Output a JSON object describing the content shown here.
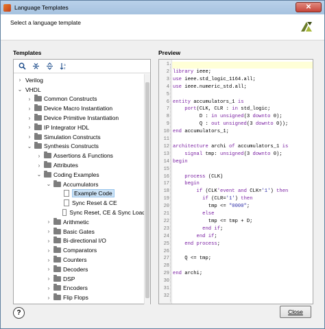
{
  "window": {
    "title": "Language Templates",
    "close_glyph": "✕"
  },
  "header": {
    "subtitle": "Select a language template"
  },
  "templates": {
    "label": "Templates",
    "toolbar": [
      "search-icon",
      "collapse-all-icon",
      "expand-all-icon",
      "sort-icon"
    ],
    "tree": [
      {
        "label": "Verilog",
        "chev": "›",
        "level": 0,
        "kind": "root"
      },
      {
        "label": "VHDL",
        "chev": "⌄",
        "level": 0,
        "kind": "root"
      },
      {
        "label": "Common Constructs",
        "chev": "›",
        "level": 1,
        "kind": "folder"
      },
      {
        "label": "Device Macro Instantiation",
        "chev": "›",
        "level": 1,
        "kind": "folder"
      },
      {
        "label": "Device Primitive Instantiation",
        "chev": "›",
        "level": 1,
        "kind": "folder"
      },
      {
        "label": "IP Integrator HDL",
        "chev": "›",
        "level": 1,
        "kind": "folder"
      },
      {
        "label": "Simulation Constructs",
        "chev": "›",
        "level": 1,
        "kind": "folder"
      },
      {
        "label": "Synthesis Constructs",
        "chev": "⌄",
        "level": 1,
        "kind": "folder"
      },
      {
        "label": "Assertions & Functions",
        "chev": "›",
        "level": 2,
        "kind": "folder"
      },
      {
        "label": "Attributes",
        "chev": "›",
        "level": 2,
        "kind": "folder"
      },
      {
        "label": "Coding Examples",
        "chev": "⌄",
        "level": 2,
        "kind": "folder"
      },
      {
        "label": "Accumulators",
        "chev": "⌄",
        "level": 3,
        "kind": "folder"
      },
      {
        "label": "Example Code",
        "chev": "",
        "level": 4,
        "kind": "doc",
        "selected": true
      },
      {
        "label": "Sync Reset & CE",
        "chev": "",
        "level": 4,
        "kind": "doc"
      },
      {
        "label": "Sync Reset, CE & Sync Load",
        "chev": "",
        "level": 4,
        "kind": "doc"
      },
      {
        "label": "Arithmetic",
        "chev": "›",
        "level": 3,
        "kind": "folder"
      },
      {
        "label": "Basic Gates",
        "chev": "›",
        "level": 3,
        "kind": "folder"
      },
      {
        "label": "Bi-directional I/O",
        "chev": "›",
        "level": 3,
        "kind": "folder"
      },
      {
        "label": "Comparators",
        "chev": "›",
        "level": 3,
        "kind": "folder"
      },
      {
        "label": "Counters",
        "chev": "›",
        "level": 3,
        "kind": "folder"
      },
      {
        "label": "Decoders",
        "chev": "›",
        "level": 3,
        "kind": "folder"
      },
      {
        "label": "DSP",
        "chev": "›",
        "level": 3,
        "kind": "folder"
      },
      {
        "label": "Encoders",
        "chev": "›",
        "level": 3,
        "kind": "folder"
      },
      {
        "label": "Flip Flops",
        "chev": "›",
        "level": 3,
        "kind": "folder"
      }
    ]
  },
  "preview": {
    "label": "Preview",
    "colors": {
      "keyword": "#7a1fa2",
      "string": "#2a2aa6",
      "text": "#000000"
    },
    "lines": [
      {
        "n": "1",
        "segs": []
      },
      {
        "n": "2",
        "segs": [
          [
            "k",
            "library"
          ],
          [
            "t",
            " ieee;"
          ]
        ]
      },
      {
        "n": "3",
        "segs": [
          [
            "k",
            "use"
          ],
          [
            "t",
            " ieee.std_logic_1164.all;"
          ]
        ]
      },
      {
        "n": "4",
        "segs": [
          [
            "k",
            "use"
          ],
          [
            "t",
            " ieee.numeric_std.all;"
          ]
        ]
      },
      {
        "n": "5",
        "segs": []
      },
      {
        "n": "6",
        "segs": [
          [
            "k",
            "entity"
          ],
          [
            "t",
            " accumulators_1 "
          ],
          [
            "k",
            "is"
          ]
        ]
      },
      {
        "n": "7",
        "segs": [
          [
            "t",
            "    "
          ],
          [
            "k",
            "port"
          ],
          [
            "t",
            "(CLK, CLR : "
          ],
          [
            "k",
            "in"
          ],
          [
            "t",
            " std_logic;"
          ]
        ]
      },
      {
        "n": "8",
        "segs": [
          [
            "t",
            "         D : "
          ],
          [
            "k",
            "in"
          ],
          [
            "t",
            " "
          ],
          [
            "k",
            "unsigned"
          ],
          [
            "t",
            "(3 "
          ],
          [
            "k",
            "downto"
          ],
          [
            "t",
            " 0);"
          ]
        ]
      },
      {
        "n": "9",
        "segs": [
          [
            "t",
            "         Q : "
          ],
          [
            "k",
            "out"
          ],
          [
            "t",
            " "
          ],
          [
            "k",
            "unsigned"
          ],
          [
            "t",
            "(3 "
          ],
          [
            "k",
            "downto"
          ],
          [
            "t",
            " 0));"
          ]
        ]
      },
      {
        "n": "10",
        "segs": [
          [
            "k",
            "end"
          ],
          [
            "t",
            " accumulators_1;"
          ]
        ]
      },
      {
        "n": "11",
        "segs": []
      },
      {
        "n": "12",
        "segs": [
          [
            "k",
            "architecture"
          ],
          [
            "t",
            " archi "
          ],
          [
            "k",
            "of"
          ],
          [
            "t",
            " accumulators_1 "
          ],
          [
            "k",
            "is"
          ]
        ]
      },
      {
        "n": "13",
        "segs": [
          [
            "t",
            "    "
          ],
          [
            "k",
            "signal"
          ],
          [
            "t",
            " tmp: "
          ],
          [
            "k",
            "unsigned"
          ],
          [
            "t",
            "(3 "
          ],
          [
            "k",
            "downto"
          ],
          [
            "t",
            " 0);"
          ]
        ]
      },
      {
        "n": "14",
        "segs": [
          [
            "k",
            "begin"
          ]
        ]
      },
      {
        "n": "15",
        "segs": []
      },
      {
        "n": "16",
        "segs": [
          [
            "t",
            "    "
          ],
          [
            "k",
            "process"
          ],
          [
            "t",
            " (CLK)"
          ]
        ]
      },
      {
        "n": "17",
        "segs": [
          [
            "t",
            "    "
          ],
          [
            "k",
            "begin"
          ]
        ]
      },
      {
        "n": "18",
        "segs": [
          [
            "t",
            "        "
          ],
          [
            "k",
            "if"
          ],
          [
            "t",
            " (CLK"
          ],
          [
            "k",
            "'event"
          ],
          [
            "t",
            " "
          ],
          [
            "k",
            "and"
          ],
          [
            "t",
            " CLK="
          ],
          [
            "s",
            "'1'"
          ],
          [
            "t",
            ") "
          ],
          [
            "k",
            "then"
          ]
        ]
      },
      {
        "n": "19",
        "segs": [
          [
            "t",
            "          "
          ],
          [
            "k",
            "if"
          ],
          [
            "t",
            " (CLR="
          ],
          [
            "s",
            "'1'"
          ],
          [
            "t",
            ") "
          ],
          [
            "k",
            "then"
          ]
        ]
      },
      {
        "n": "20",
        "segs": [
          [
            "t",
            "            tmp <= "
          ],
          [
            "s",
            "\"0000\""
          ],
          [
            "t",
            ";"
          ]
        ]
      },
      {
        "n": "21",
        "segs": [
          [
            "t",
            "          "
          ],
          [
            "k",
            "else"
          ]
        ]
      },
      {
        "n": "22",
        "segs": [
          [
            "t",
            "            tmp <= tmp + D;"
          ]
        ]
      },
      {
        "n": "23",
        "segs": [
          [
            "t",
            "          "
          ],
          [
            "k",
            "end if"
          ],
          [
            "t",
            ";"
          ]
        ]
      },
      {
        "n": "24",
        "segs": [
          [
            "t",
            "        "
          ],
          [
            "k",
            "end if"
          ],
          [
            "t",
            ";"
          ]
        ]
      },
      {
        "n": "25",
        "segs": [
          [
            "t",
            "    "
          ],
          [
            "k",
            "end process"
          ],
          [
            "t",
            ";"
          ]
        ]
      },
      {
        "n": "26",
        "segs": []
      },
      {
        "n": "27",
        "segs": [
          [
            "t",
            "    Q <= tmp;"
          ]
        ]
      },
      {
        "n": "28",
        "segs": []
      },
      {
        "n": "29",
        "segs": [
          [
            "k",
            "end"
          ],
          [
            "t",
            " archi;"
          ]
        ]
      },
      {
        "n": "30",
        "segs": []
      },
      {
        "n": "31",
        "segs": []
      },
      {
        "n": "32",
        "segs": []
      }
    ]
  },
  "footer": {
    "help_label": "?",
    "close_label": "Close"
  }
}
